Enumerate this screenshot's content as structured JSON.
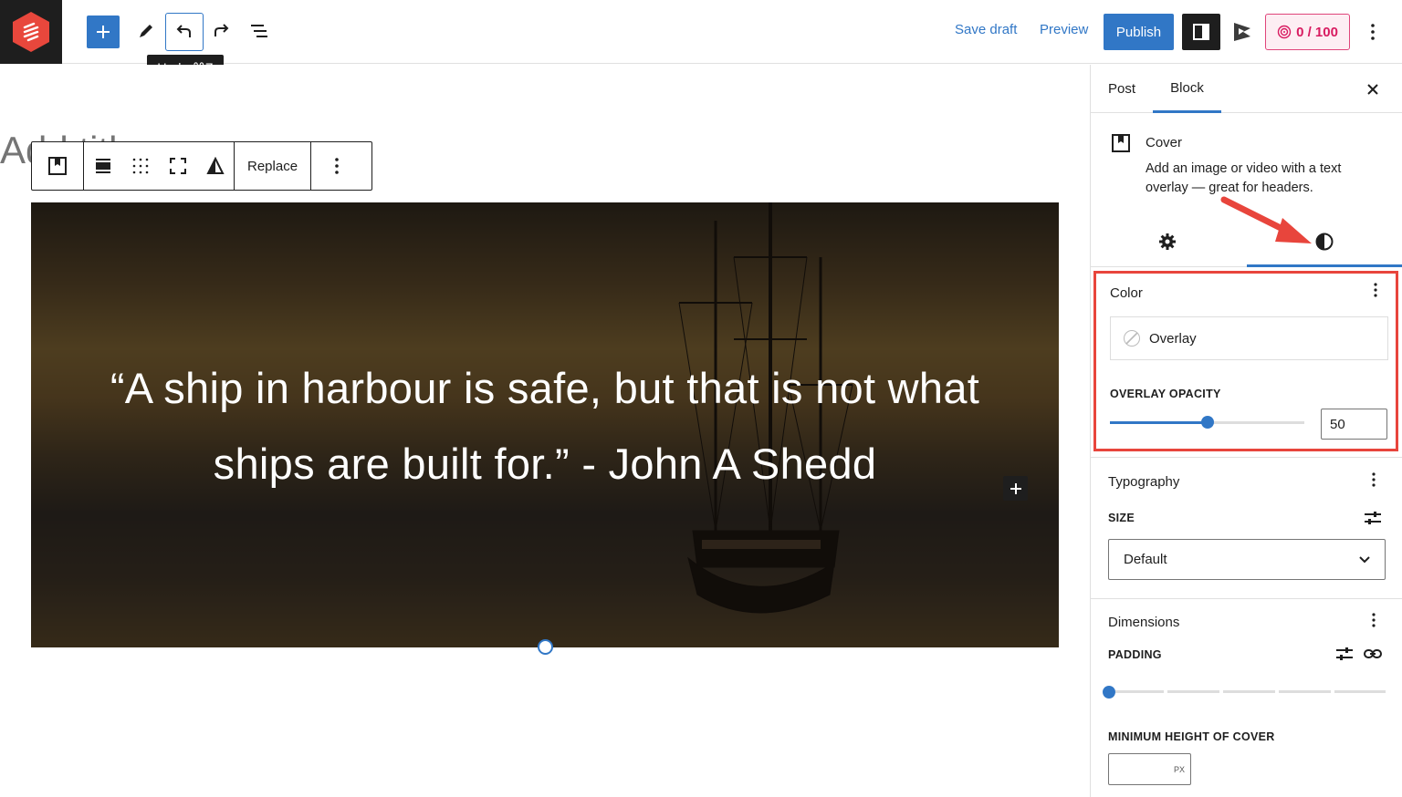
{
  "topbar": {
    "tooltip": "Undo ⌘Z",
    "save_draft": "Save draft",
    "preview": "Preview",
    "publish": "Publish",
    "score": "0 / 100"
  },
  "editor": {
    "ghost_title": "Add title",
    "block_toolbar": {
      "replace": "Replace"
    },
    "quote": "“A ship in harbour is safe, but that is not what ships are built for.” - John A Shedd"
  },
  "sidebar": {
    "tabs": [
      "Post",
      "Block"
    ],
    "active_tab": "Block",
    "block": {
      "title": "Cover",
      "description": "Add an image or video with a text overlay — great for headers."
    },
    "color": {
      "heading": "Color",
      "overlay_label": "Overlay",
      "opacity_label": "OVERLAY OPACITY",
      "opacity_value": "50",
      "opacity_fraction": 0.5
    },
    "typography": {
      "heading": "Typography",
      "size_label": "SIZE",
      "size_value": "Default"
    },
    "dimensions": {
      "heading": "Dimensions",
      "padding_label": "PADDING",
      "min_height_label": "MINIMUM HEIGHT OF COVER",
      "min_height_unit": "PX"
    }
  },
  "colors": {
    "accent": "#3177c6",
    "highlight": "#e8453c",
    "score": "#d81b60"
  }
}
